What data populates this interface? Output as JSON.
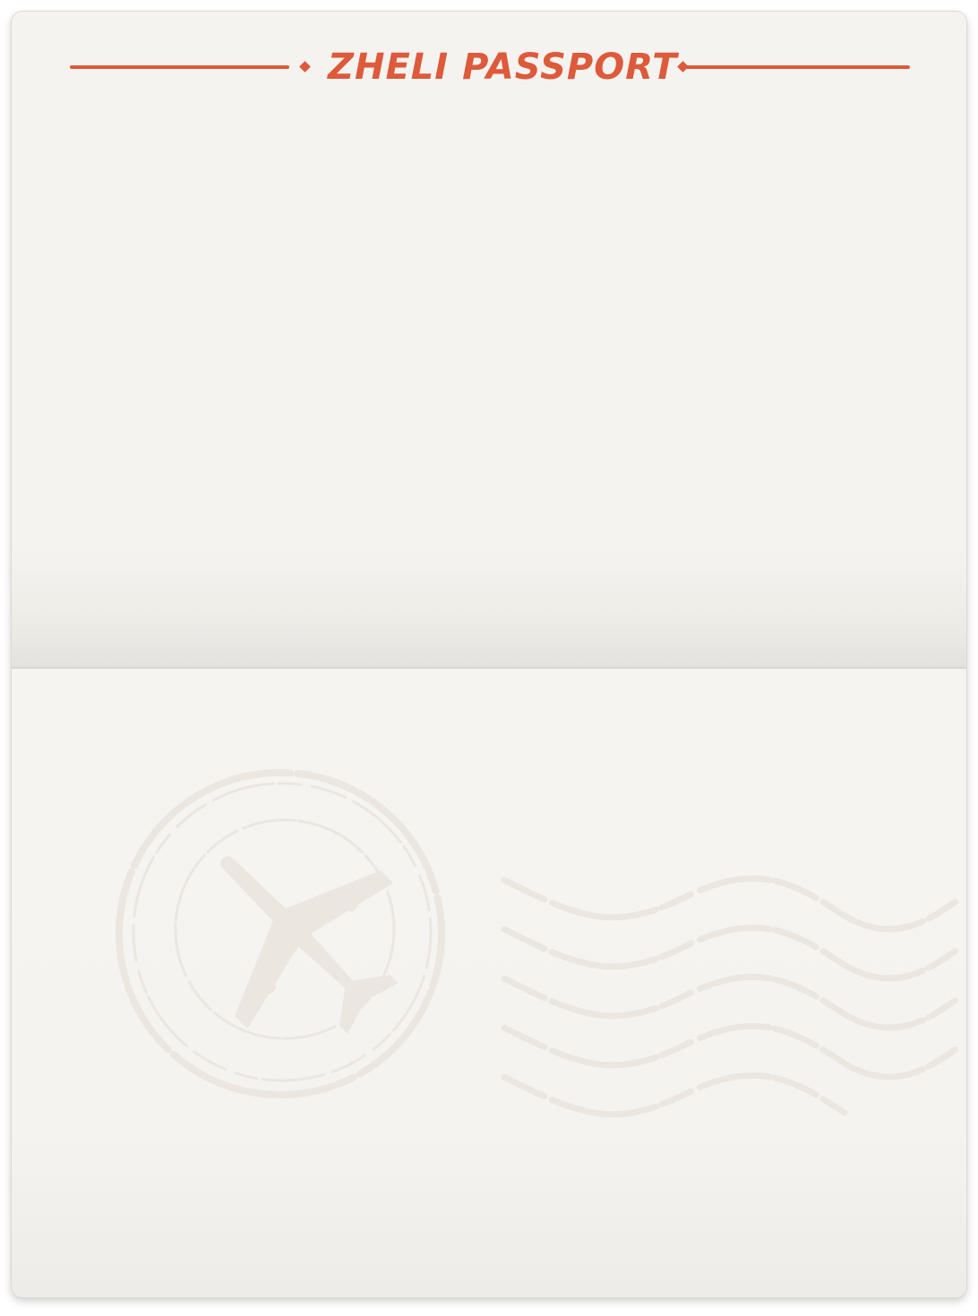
{
  "header": {
    "title": "ZHELI PASSPORT"
  },
  "icons": {
    "stamp": "airplane-stamp-icon",
    "postmark": "postmark-waves-icon"
  },
  "colors": {
    "accent": "#dd5a3b",
    "page": "#f5f3ef",
    "stamp_ink": "#ebe6e0"
  }
}
